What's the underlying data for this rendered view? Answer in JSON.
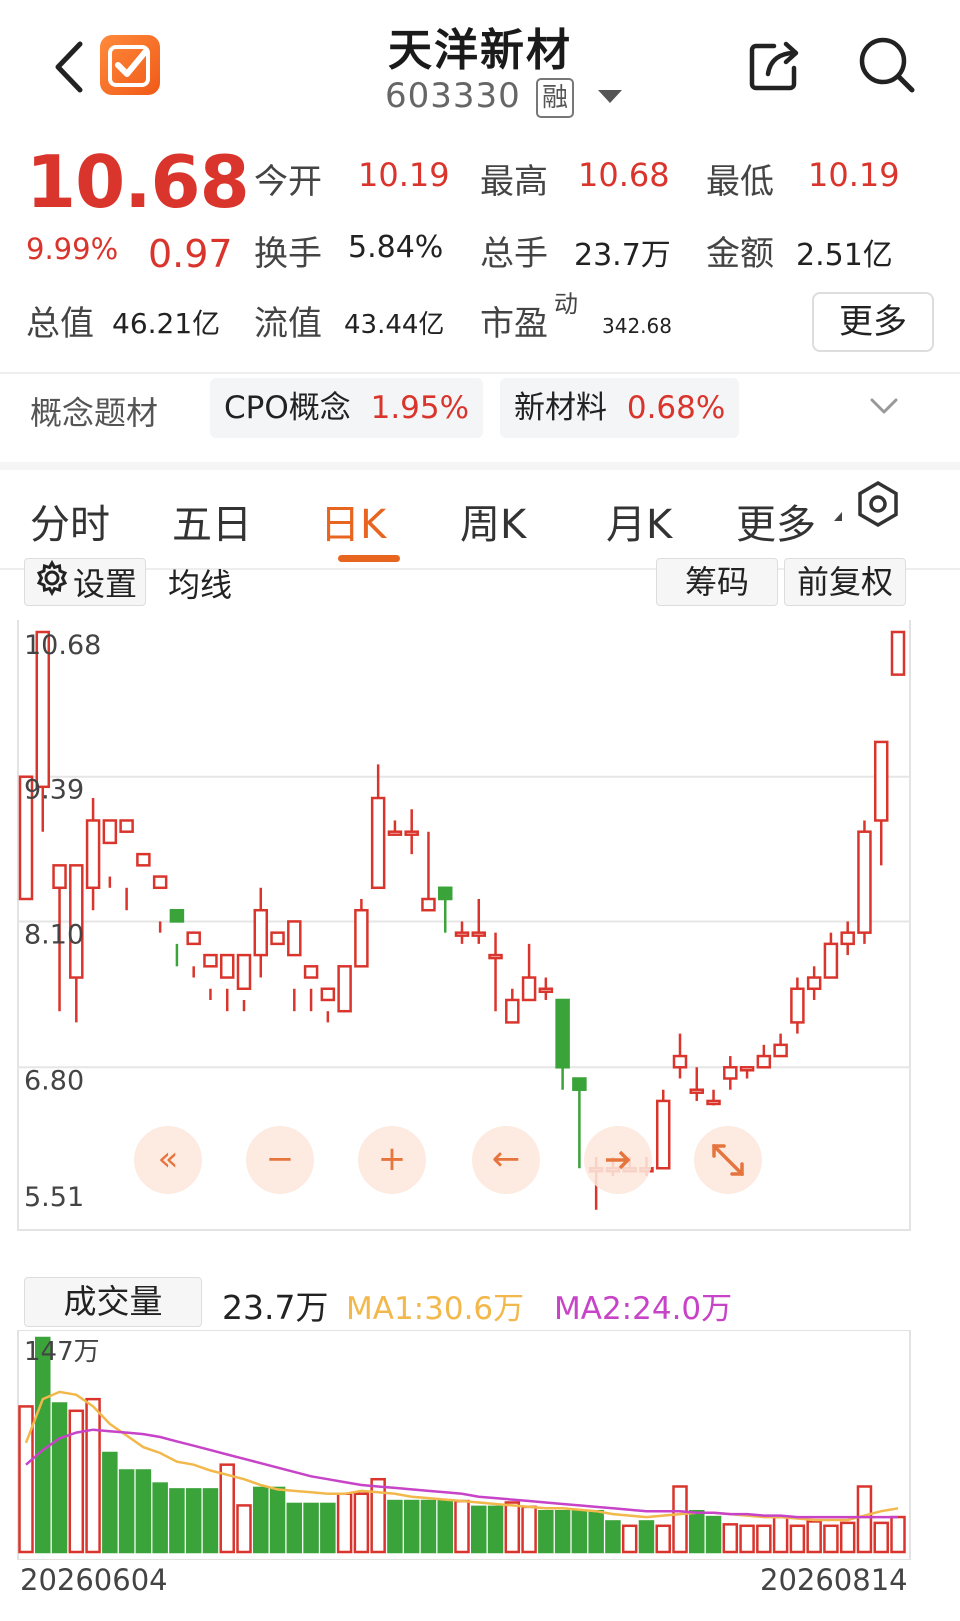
{
  "header": {
    "title": "天洋新材",
    "code": "603330",
    "margin_badge": "融"
  },
  "quote": {
    "price": "10.68",
    "change_pct": "9.99%",
    "change": "0.97",
    "open_label": "今开",
    "open": "10.19",
    "high_label": "最高",
    "high": "10.68",
    "low_label": "最低",
    "low": "10.19",
    "turnover_label": "换手",
    "turnover": "5.84%",
    "volume_label": "总手",
    "volume": "23.7万",
    "amount_label": "金额",
    "amount": "2.51亿",
    "mktcap_label": "总值",
    "mktcap": "46.21亿",
    "float_label": "流值",
    "float_cap": "43.44亿",
    "pe_label": "市盈",
    "pe_sup": "动",
    "pe": "342.68",
    "more_label": "更多"
  },
  "concepts": {
    "label": "概念题材",
    "items": [
      {
        "name": "CPO概念",
        "pct": "1.95%"
      },
      {
        "name": "新材料",
        "pct": "0.68%"
      }
    ]
  },
  "tabs": [
    {
      "label": "分时",
      "active": false
    },
    {
      "label": "五日",
      "active": false
    },
    {
      "label": "日K",
      "active": true
    },
    {
      "label": "周K",
      "active": false
    },
    {
      "label": "月K",
      "active": false
    },
    {
      "label": "更多",
      "active": false
    }
  ],
  "chart_toolbar": {
    "settings": "设置",
    "ma": "均线",
    "chips": "筹码",
    "adjust": "前复权"
  },
  "colors": {
    "up": "#d9352c",
    "down": "#3aa33a",
    "accent": "#e8651f",
    "ma1": "#f2b84b",
    "ma2": "#c743c7"
  },
  "chart_data": {
    "type": "candlestick",
    "y_ticks": [
      "10.68",
      "9.39",
      "8.10",
      "6.80",
      "5.51"
    ],
    "ylim": [
      5.51,
      10.68
    ],
    "x_start": "20260604",
    "x_end": "20260814",
    "candles": [
      [
        8.3,
        9.39,
        8.9,
        9.1
      ],
      [
        9.3,
        10.68,
        10.5,
        8.9
      ],
      [
        8.4,
        8.6,
        7.3,
        8.4
      ],
      [
        7.6,
        8.6,
        7.2,
        8.1
      ],
      [
        8.4,
        9.0,
        8.2,
        9.2
      ],
      [
        8.8,
        9.0,
        8.5,
        8.4
      ],
      [
        8.9,
        9.0,
        8.4,
        8.2
      ],
      [
        8.6,
        8.7,
        8.3,
        8.3
      ],
      [
        8.4,
        8.5,
        8.1,
        8.0
      ],
      [
        8.2,
        8.1,
        7.7,
        7.9
      ],
      [
        7.9,
        8.0,
        7.7,
        7.6
      ],
      [
        7.7,
        7.8,
        7.5,
        7.4
      ],
      [
        7.6,
        7.8,
        7.5,
        7.3
      ],
      [
        7.5,
        7.8,
        7.3,
        7.4
      ],
      [
        7.8,
        8.2,
        7.6,
        8.4
      ],
      [
        7.9,
        8.0,
        7.7,
        7.7
      ],
      [
        7.8,
        8.1,
        7.5,
        7.3
      ],
      [
        7.6,
        7.7,
        7.5,
        7.3
      ],
      [
        7.4,
        7.5,
        7.3,
        7.2
      ],
      [
        7.3,
        7.7,
        7.4,
        7.6
      ],
      [
        7.7,
        8.2,
        7.7,
        8.3
      ],
      [
        8.4,
        9.2,
        8.8,
        9.5
      ],
      [
        8.9,
        8.9,
        8.9,
        9.0
      ],
      [
        8.9,
        8.9,
        8.7,
        9.1
      ],
      [
        8.2,
        8.3,
        8.2,
        8.9
      ],
      [
        8.4,
        8.3,
        8.0,
        8.4
      ],
      [
        8.0,
        8.0,
        7.9,
        8.1
      ],
      [
        8.0,
        8.0,
        7.9,
        8.3
      ],
      [
        7.8,
        7.8,
        7.3,
        8.0
      ],
      [
        7.2,
        7.4,
        7.3,
        7.5
      ],
      [
        7.4,
        7.6,
        7.4,
        7.9
      ],
      [
        7.5,
        7.5,
        7.4,
        7.6
      ],
      [
        7.4,
        6.8,
        6.6,
        7.4
      ],
      [
        6.7,
        6.6,
        5.9,
        6.7
      ],
      [
        5.9,
        5.9,
        5.53,
        6.0
      ],
      [
        5.9,
        5.9,
        5.83,
        6.0
      ],
      [
        5.9,
        5.9,
        5.88,
        6.0
      ],
      [
        5.9,
        5.9,
        5.83,
        6.0
      ],
      [
        5.9,
        6.5,
        5.9,
        6.6
      ],
      [
        6.8,
        6.9,
        6.7,
        7.1
      ],
      [
        6.6,
        6.6,
        6.5,
        6.8
      ],
      [
        6.5,
        6.5,
        6.46,
        6.6
      ],
      [
        6.7,
        6.8,
        6.6,
        6.9
      ],
      [
        6.8,
        6.8,
        6.7,
        6.8
      ],
      [
        6.8,
        6.9,
        6.8,
        7.0
      ],
      [
        6.9,
        7.0,
        6.9,
        7.1
      ],
      [
        7.2,
        7.5,
        7.1,
        7.6
      ],
      [
        7.5,
        7.6,
        7.4,
        7.7
      ],
      [
        7.6,
        7.9,
        7.6,
        8.0
      ],
      [
        7.9,
        8.0,
        7.8,
        8.1
      ],
      [
        8.0,
        8.9,
        7.9,
        9.0
      ],
      [
        9.0,
        9.7,
        8.6,
        9.7
      ],
      [
        10.3,
        10.68,
        10.3,
        10.68
      ]
    ]
  },
  "volume": {
    "label": "成交量",
    "current": "23.7万",
    "ma1_label": "MA1:30.6万",
    "ma2_label": "MA2:24.0万",
    "max_label": "147万",
    "bars": [
      [
        100,
        1
      ],
      [
        147,
        0
      ],
      [
        102,
        0
      ],
      [
        97,
        1
      ],
      [
        105,
        1
      ],
      [
        68,
        0
      ],
      [
        56,
        0
      ],
      [
        56,
        0
      ],
      [
        47,
        0
      ],
      [
        43,
        0
      ],
      [
        43,
        0
      ],
      [
        43,
        0
      ],
      [
        60,
        1
      ],
      [
        32,
        1
      ],
      [
        44,
        0
      ],
      [
        44,
        0
      ],
      [
        33,
        0
      ],
      [
        33,
        0
      ],
      [
        33,
        0
      ],
      [
        40,
        1
      ],
      [
        40,
        1
      ],
      [
        50,
        1
      ],
      [
        35,
        0
      ],
      [
        35,
        0
      ],
      [
        35,
        0
      ],
      [
        35,
        0
      ],
      [
        35,
        1
      ],
      [
        31,
        0
      ],
      [
        31,
        0
      ],
      [
        34,
        1
      ],
      [
        31,
        1
      ],
      [
        28,
        0
      ],
      [
        28,
        0
      ],
      [
        28,
        0
      ],
      [
        28,
        0
      ],
      [
        21,
        0
      ],
      [
        18,
        1
      ],
      [
        21,
        0
      ],
      [
        18,
        1
      ],
      [
        45,
        1
      ],
      [
        28,
        0
      ],
      [
        24,
        0
      ],
      [
        19,
        1
      ],
      [
        18,
        1
      ],
      [
        18,
        1
      ],
      [
        24,
        1
      ],
      [
        18,
        1
      ],
      [
        21,
        1
      ],
      [
        18,
        1
      ],
      [
        20,
        1
      ],
      [
        45,
        1
      ],
      [
        20,
        1
      ],
      [
        24,
        1
      ]
    ],
    "ma1": [
      75,
      105,
      110,
      108,
      100,
      88,
      80,
      72,
      68,
      62,
      60,
      56,
      53,
      50,
      46,
      43,
      42,
      41,
      40,
      40,
      42,
      41,
      40,
      38,
      37,
      36,
      35,
      34,
      33,
      32,
      31,
      30,
      30,
      29,
      28,
      26,
      25,
      24,
      25,
      26,
      27,
      27,
      26,
      25,
      24,
      24,
      23,
      22,
      22,
      22,
      25,
      28,
      30
    ],
    "ma2": [
      60,
      70,
      78,
      82,
      84,
      83,
      82,
      81,
      79,
      76,
      73,
      70,
      67,
      64,
      61,
      58,
      55,
      52,
      50,
      48,
      46,
      45,
      44,
      43,
      42,
      41,
      40,
      38,
      37,
      36,
      35,
      34,
      33,
      32,
      31,
      30,
      29,
      28,
      28,
      28,
      27,
      27,
      26,
      26,
      25,
      25,
      24,
      24,
      24,
      24,
      24,
      24,
      24
    ]
  },
  "nav_controls": {
    "rewind": "«",
    "zoom_out": "−",
    "zoom_in": "+",
    "left": "←"
  }
}
